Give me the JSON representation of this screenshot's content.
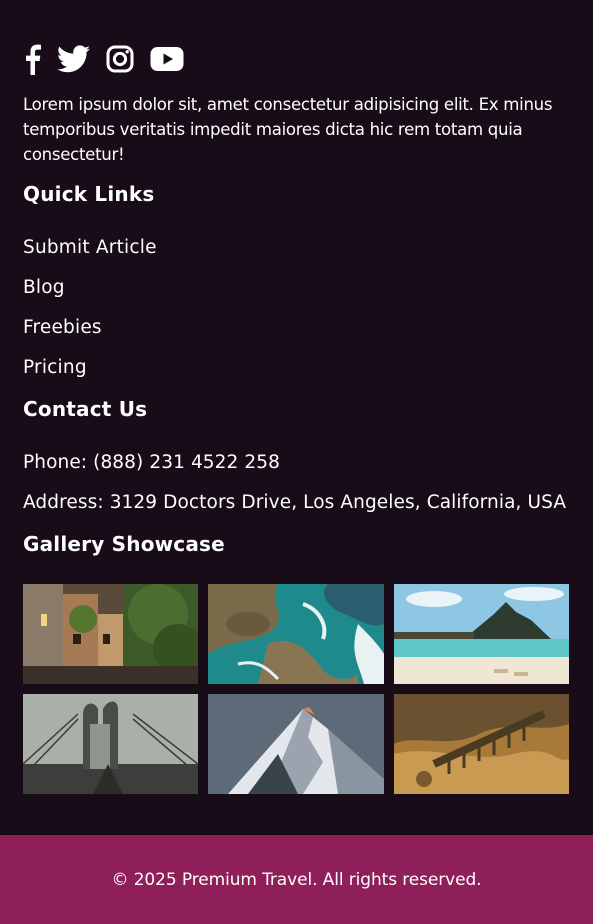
{
  "social": {
    "icons": [
      "facebook-icon",
      "twitter-icon",
      "instagram-icon",
      "youtube-icon"
    ]
  },
  "about": {
    "text": "Lorem ipsum dolor sit, amet consectetur adipisicing elit. Ex minus temporibus veritatis impedit maiores dicta hic rem totam quia consectetur!"
  },
  "quick_links": {
    "heading": "Quick Links",
    "items": [
      "Submit Article",
      "Blog",
      "Freebies",
      "Pricing"
    ]
  },
  "contact": {
    "heading": "Contact Us",
    "phone": "Phone: (888) 231 4522 258",
    "address": "Address: 3129 Doctors Drive, Los Angeles, California, USA"
  },
  "gallery": {
    "heading": "Gallery Showcase",
    "images": [
      "street-photo",
      "coast-aerial-photo",
      "tropical-beach-photo",
      "bridge-photo",
      "snowy-mountain-photo",
      "aqueduct-photo"
    ]
  },
  "footer": {
    "copyright": "© 2025 Premium Travel. All rights reserved."
  },
  "colors": {
    "background": "#170c17",
    "accent_bar": "#8e1f58",
    "text": "#ffffff"
  }
}
